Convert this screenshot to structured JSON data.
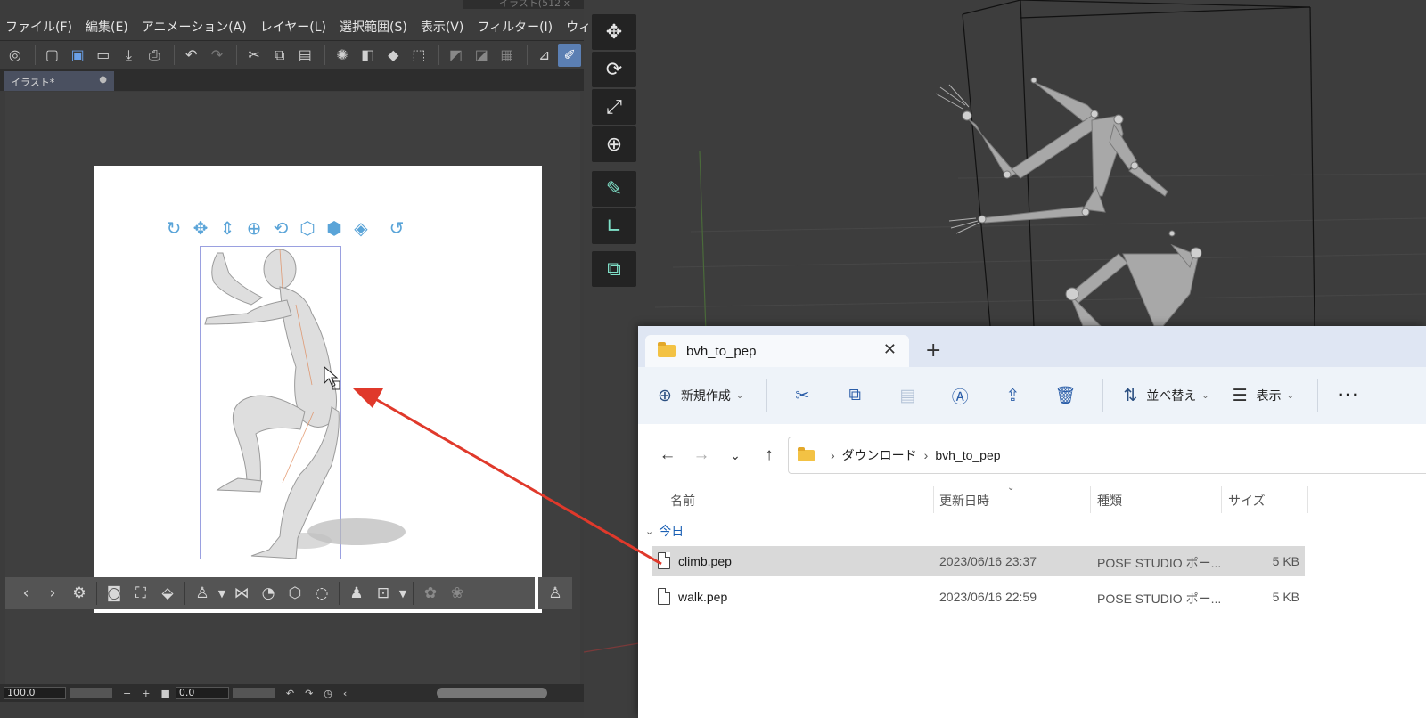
{
  "csp": {
    "title_fragment": "イラスト(512 x",
    "menu": [
      "ファイル(F)",
      "編集(E)",
      "アニメーション(A)",
      "レイヤー(L)",
      "選択範囲(S)",
      "表示(V)",
      "フィルター(I)",
      "ウィ"
    ],
    "doc_tab": "イラスト*",
    "doc_tab_dot": "●",
    "status": {
      "zoom": "100.0",
      "minus": "−",
      "plus": "+",
      "square": "■",
      "angle": "0.0"
    }
  },
  "explorer": {
    "tab_title": "bvh_to_pep",
    "close_glyph": "✕",
    "new_tab_glyph": "+",
    "cmd": {
      "new_label": "新規作成",
      "sort_label": "並べ替え",
      "view_label": "表示",
      "more": "···"
    },
    "breadcrumb": [
      "ダウンロード",
      "bvh_to_pep"
    ],
    "columns": {
      "name": "名前",
      "date": "更新日時",
      "type": "種類",
      "size": "サイズ"
    },
    "group": "今日",
    "files": [
      {
        "name": "climb.pep",
        "date": "2023/06/16 23:37",
        "type": "POSE STUDIO ポー...",
        "size": "5 KB",
        "selected": true
      },
      {
        "name": "walk.pep",
        "date": "2023/06/16 22:59",
        "type": "POSE STUDIO ポー...",
        "size": "5 KB",
        "selected": false
      }
    ]
  },
  "colors": {
    "arrow": "#e0392b",
    "manip_blue": "#5aa4d8",
    "selection_gray": "#d9d9d9"
  }
}
